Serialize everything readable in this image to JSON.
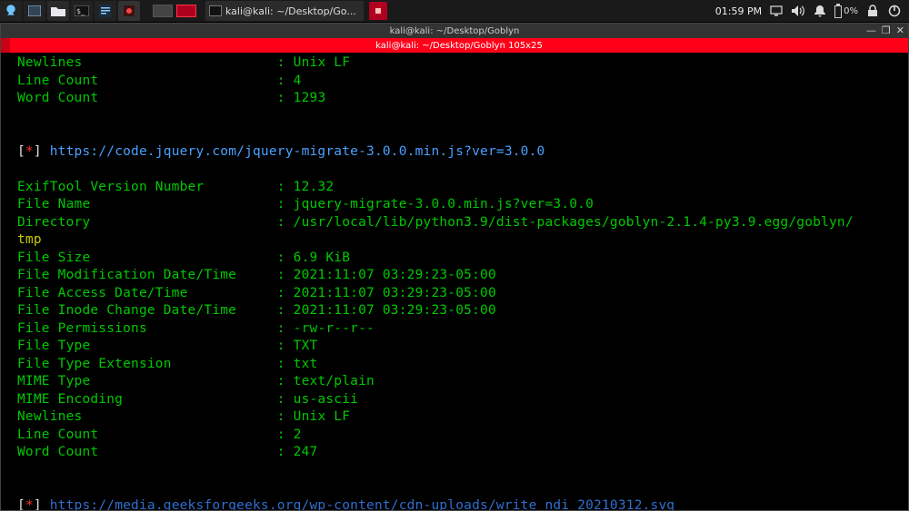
{
  "taskbar": {
    "task_label": "kali@kali: ~/Desktop/Go...",
    "clock": "01:59 PM",
    "battery_pct": "0%"
  },
  "window": {
    "title": "kali@kali: ~/Desktop/Goblyn",
    "tab_label": "kali@kali: ~/Desktop/Goblyn 105x25",
    "minimize": "—",
    "maximize": "❐",
    "close": "✕"
  },
  "top_block": {
    "newlines": {
      "k": "Newlines",
      "v": "Unix LF"
    },
    "line_count": {
      "k": "Line Count",
      "v": "4"
    },
    "word_count": {
      "k": "Word Count",
      "v": "1293"
    }
  },
  "marker": {
    "l": "[",
    "star": "*",
    "r": "]"
  },
  "url1": "https://code.jquery.com/jquery-migrate-3.0.0.min.js?ver=3.0.0",
  "exif": {
    "ver": {
      "k": "ExifTool Version Number",
      "v": "12.32"
    },
    "fname": {
      "k": "File Name",
      "v": "jquery-migrate-3.0.0.min.js?ver=3.0.0"
    },
    "dir": {
      "k": "Directory",
      "v": "/usr/local/lib/python3.9/dist-packages/goblyn-2.1.4-py3.9.egg/goblyn/"
    },
    "dir_wrap": "tmp",
    "fsize": {
      "k": "File Size",
      "v": "6.9 KiB"
    },
    "mtime": {
      "k": "File Modification Date/Time",
      "v": "2021:11:07 03:29:23-05:00"
    },
    "atime": {
      "k": "File Access Date/Time",
      "v": "2021:11:07 03:29:23-05:00"
    },
    "ctime": {
      "k": "File Inode Change Date/Time",
      "v": "2021:11:07 03:29:23-05:00"
    },
    "perm": {
      "k": "File Permissions",
      "v": "-rw-r--r--"
    },
    "ftype": {
      "k": "File Type",
      "v": "TXT"
    },
    "fext": {
      "k": "File Type Extension",
      "v": "txt"
    },
    "mime": {
      "k": "MIME Type",
      "v": "text/plain"
    },
    "menc": {
      "k": "MIME Encoding",
      "v": "us-ascii"
    },
    "nl": {
      "k": "Newlines",
      "v": "Unix LF"
    },
    "lc": {
      "k": "Line Count",
      "v": "2"
    },
    "wc": {
      "k": "Word Count",
      "v": "247"
    }
  },
  "url2": "https://media.geeksforgeeks.org/wp-content/cdn-uploads/write_ndi_20210312.svg"
}
